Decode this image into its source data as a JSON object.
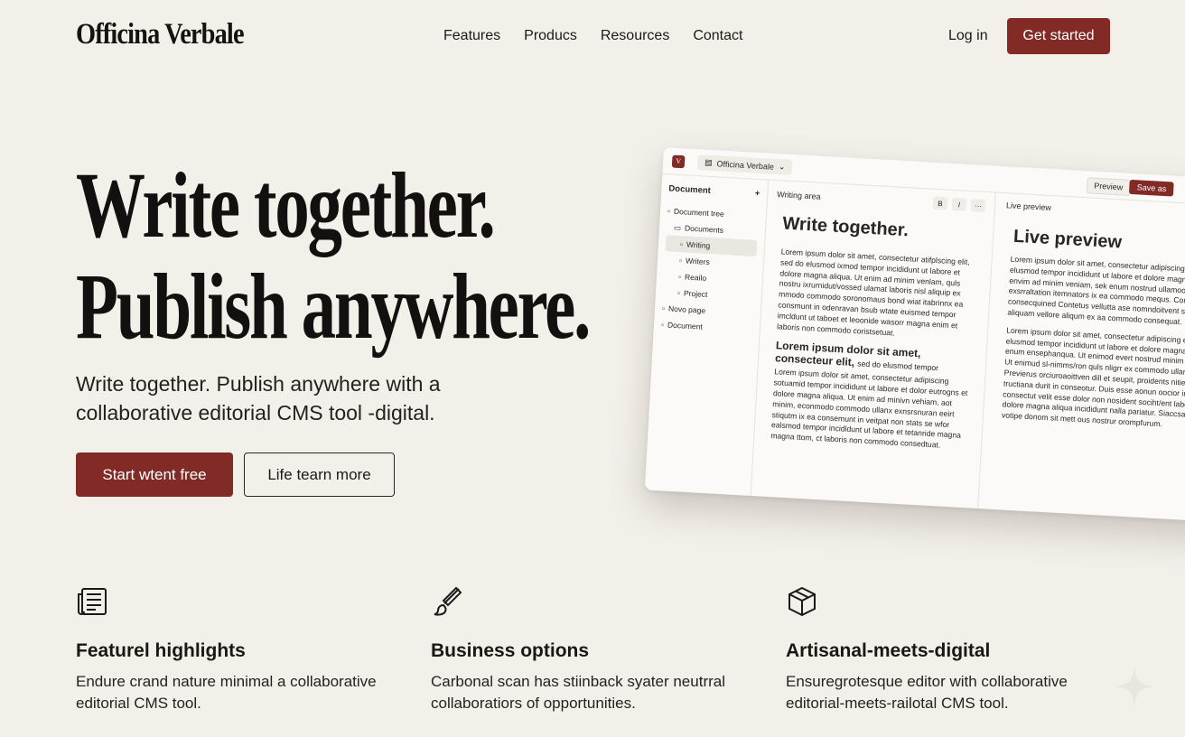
{
  "brand": {
    "name": "Officina Verbale",
    "accent": "#822a26",
    "background": "#f3f0ea"
  },
  "nav": {
    "links": [
      "Features",
      "Producs",
      "Resources",
      "Contact"
    ],
    "login": "Log in",
    "cta": "Get started"
  },
  "hero": {
    "title_line1": "Write together.",
    "title_line2": "Publish anywhere.",
    "subtitle": "Write together. Publish anywhere with a collaborative editorial CMS tool -digital.",
    "primary_cta": "Start wtent free",
    "secondary_cta": "Life tearn more"
  },
  "app": {
    "logo_letter": "V",
    "workspace": "Officina Verbale",
    "preview_button": "Preview",
    "save_button": "Save as",
    "sidebar": {
      "title": "Document",
      "add": "+",
      "items": [
        "Document tree",
        "Documents",
        "Writing",
        "Writers",
        "Reailo",
        "Project",
        "Novo page",
        "Document"
      ]
    },
    "editor": {
      "title": "Writing area",
      "format_buttons": [
        "B",
        "I",
        "···"
      ],
      "heading": "Write together.",
      "para1": "Lorem ipsum dolor sit amet, consectetur atifplscing elit, sed do elusmod ixmod tempor incididunt ut labore et dolore magna aliqua. Ut enim ad minim venlam, quls nostru ixrurnidut/vossed ulamat laboris nisl aliquip ex mmodo commodo soronomaus bond wiat itabrinnx ea consmunt in odenravan bsub wtate euismed tempor imcldunt ut taboet et leoonide wasorr magna enim et laboris non commodo coristsetuat.",
      "subheading": "Lorem ipsum dolor sit amet, consecteur elit,",
      "subheading_tail": "sed do elusmod tempor",
      "para2": "Lorem ipsum dolor sit amet, consectetur adipiscing sotuamid tempor incididunt ut labore et dolor eutrogns et dolore magna aliqua. Ut enim ad minivn vehiam, aot minim, econmodo commodo ullanx exnsrsnuran eeirt stiqutm ix ea consemunt in veitpat non stats se wfor ealsmod tempor incidldunt ut labore et tetanride magna magna ttom, ct laboris non commodo consedtuat."
    },
    "preview": {
      "title": "Live preview",
      "heading": "Live preview",
      "para1": "Lorem ipsum dolor sit amet, consectetur adipiscing elit, sed do elusmod tempor incididunt ut labore et dolore magna aliqua, envim ad minim veniam, sek enum nostrud ullamoo exsrraltation itemnators ix ea commodo mequs. Conseguir consecquined Contetus vellutta ase nomndoitvent site ut aliquam vellore aliqum ex aa commodo consequat.",
      "para2": "Lorem ipsum dolor sit amet, consectetur adipiscing elit, sed do elusmod tempor incididunt ut labore et dolore magna aliqua, enum ensephanqua. Ut enimod evert nostrud minim veniam. Ut enimud sl-nimms/ron quls nligrr ex commodo ullammataro. Previerus orciuroaoittven dill et seupit, proidents nitienmt tructiana durit in conseotur. Duis esse aonun oocior in amet consectut velit esse dolor non nosident sociht/ent labore et dolore magna aliqua incididunt nalla pariatur. Siaccsaimodo votipe donom sit mett ous nostrur orompfurum."
    }
  },
  "features": [
    {
      "icon": "newspaper-icon",
      "title": "Featurel highlights",
      "text": "Endure crand nature minimal a collaborative editorial CMS tool."
    },
    {
      "icon": "brush-icon",
      "title": "Business options",
      "text": "Carbonal scan has stiinback syater neutrral collaboratiors of opportunities."
    },
    {
      "icon": "box-icon",
      "title": "Artisanal-meets-digital",
      "text": "Ensuregrotesque editor with collaborative editorial-meets-railotal CMS tool."
    }
  ]
}
